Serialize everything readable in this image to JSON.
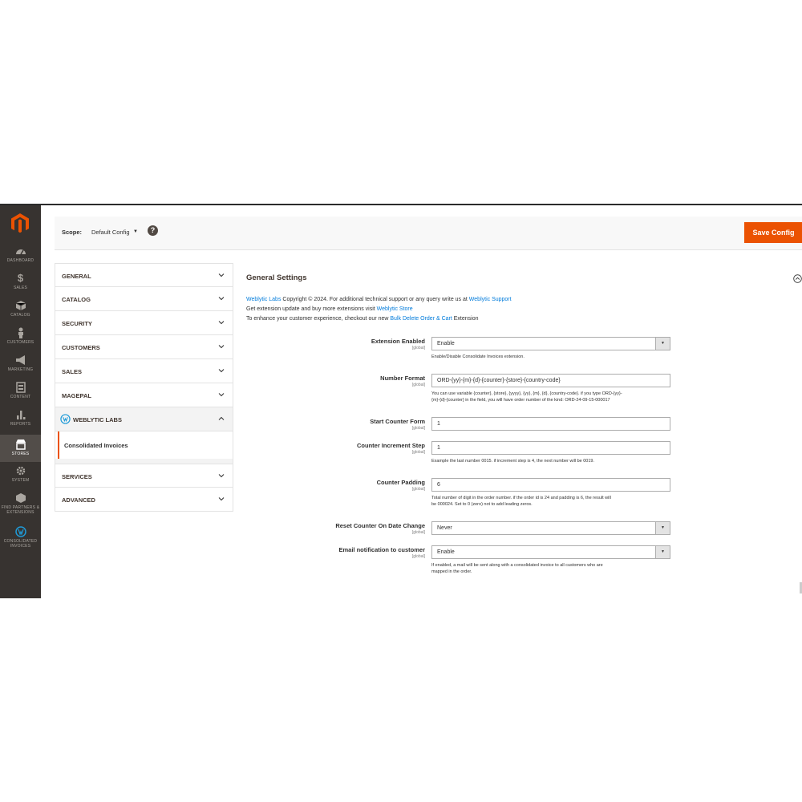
{
  "admin_menu": {
    "items": [
      {
        "label": "DASHBOARD",
        "icon": "dashboard-icon"
      },
      {
        "label": "SALES",
        "icon": "dollar-icon"
      },
      {
        "label": "CATALOG",
        "icon": "box-icon"
      },
      {
        "label": "CUSTOMERS",
        "icon": "person-icon"
      },
      {
        "label": "MARKETING",
        "icon": "megaphone-icon"
      },
      {
        "label": "CONTENT",
        "icon": "content-icon"
      },
      {
        "label": "REPORTS",
        "icon": "bar-chart-icon"
      },
      {
        "label": "STORES",
        "icon": "store-icon"
      },
      {
        "label": "SYSTEM",
        "icon": "gear-icon"
      },
      {
        "label": "FIND PARTNERS & EXTENSIONS",
        "icon": "cube-icon"
      },
      {
        "label": "CONSOLIDATED INVOICES",
        "icon": "weblytic-icon"
      }
    ]
  },
  "header": {
    "scope_label": "Scope:",
    "scope_value": "Default Config",
    "help": "?",
    "save_label": "Save Config"
  },
  "tabs": {
    "general": "GENERAL",
    "catalog": "CATALOG",
    "security": "SECURITY",
    "customers": "CUSTOMERS",
    "sales": "SALES",
    "magepal": "MAGEPAL",
    "weblytic": "WEBLYTIC LABS",
    "consolidated": "Consolidated Invoices",
    "services": "SERVICES",
    "advanced": "ADVANCED"
  },
  "section": {
    "title": "General Settings",
    "intro1_link": "Weblytic Labs",
    "intro1_text": " Copyright © 2024. For additional technical support or any query write us at ",
    "intro1_link2": "Weblytic Support",
    "intro2_text": "Get extension update and buy more extensions visit ",
    "intro2_link": "Weblytic Store",
    "intro3_text": "To enhance your customer experience, checkout our new ",
    "intro3_link": "Bulk Delete Order & Cart",
    "intro3_tail": " Extension"
  },
  "fields": {
    "scope": "[global]",
    "ext_enabled": {
      "label": "Extension Enabled",
      "value": "Enable",
      "note": "Enable/Disable Consolidate Invoices extension."
    },
    "number_format": {
      "label": "Number Format",
      "value": "ORD-{yy}-{m}-{d}-{counter}-{store}-{country-code}",
      "note1": "You can use variable {counter}, {store}, {yyyy}, {yy}, {m}, {d}, {country-code}. if you type ORD-{yy}-",
      "note2": "{m}-{d}-{counter} in the field, you will have order number of the kind: ORD-24-09-15-000017"
    },
    "start_counter": {
      "label": "Start Counter Form",
      "value": "1"
    },
    "increment": {
      "label": "Counter Increment Step",
      "value": "1",
      "note": "Example the last number 0015. if increment step is 4, the next number will be 0019."
    },
    "padding": {
      "label": "Counter Padding",
      "value": "6",
      "note1": "Total number of digit in the order number. if the order id is 24 and padding is 6, the result will",
      "note2": "be 000024. Set to 0 (zero) not to add leading zeros."
    },
    "reset": {
      "label": "Reset Counter On Date Change",
      "value": "Never"
    },
    "email": {
      "label": "Email notification to customer",
      "value": "Enable",
      "note1": "If enabled, a mail will be sent along with a consolidated invoice to all customers who are",
      "note2": "mapped in the order."
    }
  },
  "colors": {
    "accent": "#eb5202",
    "menu_bg": "#373330",
    "link": "#007bdb"
  }
}
